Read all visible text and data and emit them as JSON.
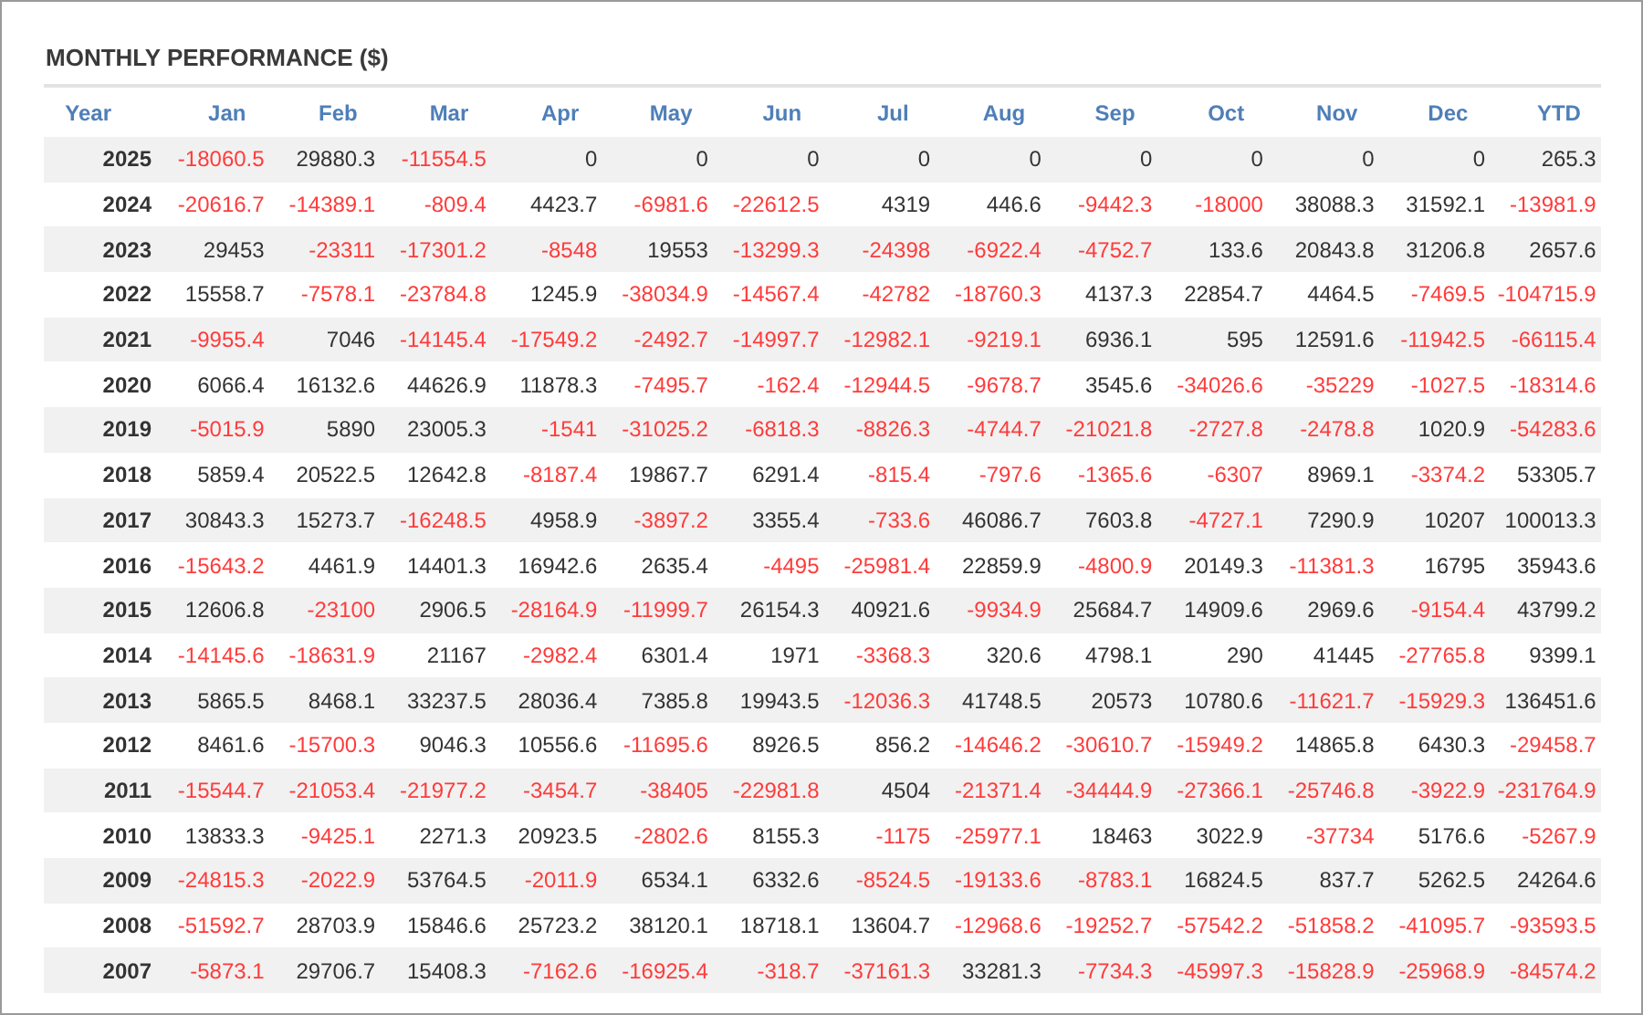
{
  "title": "MONTHLY PERFORMANCE ($)",
  "columns": [
    "Year",
    "Jan",
    "Feb",
    "Mar",
    "Apr",
    "May",
    "Jun",
    "Jul",
    "Aug",
    "Sep",
    "Oct",
    "Nov",
    "Dec",
    "YTD"
  ],
  "rows": [
    [
      "2025",
      "-18060.5",
      "29880.3",
      "-11554.5",
      "0",
      "0",
      "0",
      "0",
      "0",
      "0",
      "0",
      "0",
      "0",
      "265.3"
    ],
    [
      "2024",
      "-20616.7",
      "-14389.1",
      "-809.4",
      "4423.7",
      "-6981.6",
      "-22612.5",
      "4319",
      "446.6",
      "-9442.3",
      "-18000",
      "38088.3",
      "31592.1",
      "-13981.9"
    ],
    [
      "2023",
      "29453",
      "-23311",
      "-17301.2",
      "-8548",
      "19553",
      "-13299.3",
      "-24398",
      "-6922.4",
      "-4752.7",
      "133.6",
      "20843.8",
      "31206.8",
      "2657.6"
    ],
    [
      "2022",
      "15558.7",
      "-7578.1",
      "-23784.8",
      "1245.9",
      "-38034.9",
      "-14567.4",
      "-42782",
      "-18760.3",
      "4137.3",
      "22854.7",
      "4464.5",
      "-7469.5",
      "-104715.9"
    ],
    [
      "2021",
      "-9955.4",
      "7046",
      "-14145.4",
      "-17549.2",
      "-2492.7",
      "-14997.7",
      "-12982.1",
      "-9219.1",
      "6936.1",
      "595",
      "12591.6",
      "-11942.5",
      "-66115.4"
    ],
    [
      "2020",
      "6066.4",
      "16132.6",
      "44626.9",
      "11878.3",
      "-7495.7",
      "-162.4",
      "-12944.5",
      "-9678.7",
      "3545.6",
      "-34026.6",
      "-35229",
      "-1027.5",
      "-18314.6"
    ],
    [
      "2019",
      "-5015.9",
      "5890",
      "23005.3",
      "-1541",
      "-31025.2",
      "-6818.3",
      "-8826.3",
      "-4744.7",
      "-21021.8",
      "-2727.8",
      "-2478.8",
      "1020.9",
      "-54283.6"
    ],
    [
      "2018",
      "5859.4",
      "20522.5",
      "12642.8",
      "-8187.4",
      "19867.7",
      "6291.4",
      "-815.4",
      "-797.6",
      "-1365.6",
      "-6307",
      "8969.1",
      "-3374.2",
      "53305.7"
    ],
    [
      "2017",
      "30843.3",
      "15273.7",
      "-16248.5",
      "4958.9",
      "-3897.2",
      "3355.4",
      "-733.6",
      "46086.7",
      "7603.8",
      "-4727.1",
      "7290.9",
      "10207",
      "100013.3"
    ],
    [
      "2016",
      "-15643.2",
      "4461.9",
      "14401.3",
      "16942.6",
      "2635.4",
      "-4495",
      "-25981.4",
      "22859.9",
      "-4800.9",
      "20149.3",
      "-11381.3",
      "16795",
      "35943.6"
    ],
    [
      "2015",
      "12606.8",
      "-23100",
      "2906.5",
      "-28164.9",
      "-11999.7",
      "26154.3",
      "40921.6",
      "-9934.9",
      "25684.7",
      "14909.6",
      "2969.6",
      "-9154.4",
      "43799.2"
    ],
    [
      "2014",
      "-14145.6",
      "-18631.9",
      "21167",
      "-2982.4",
      "6301.4",
      "1971",
      "-3368.3",
      "320.6",
      "4798.1",
      "290",
      "41445",
      "-27765.8",
      "9399.1"
    ],
    [
      "2013",
      "5865.5",
      "8468.1",
      "33237.5",
      "28036.4",
      "7385.8",
      "19943.5",
      "-12036.3",
      "41748.5",
      "20573",
      "10780.6",
      "-11621.7",
      "-15929.3",
      "136451.6"
    ],
    [
      "2012",
      "8461.6",
      "-15700.3",
      "9046.3",
      "10556.6",
      "-11695.6",
      "8926.5",
      "856.2",
      "-14646.2",
      "-30610.7",
      "-15949.2",
      "14865.8",
      "6430.3",
      "-29458.7"
    ],
    [
      "2011",
      "-15544.7",
      "-21053.4",
      "-21977.2",
      "-3454.7",
      "-38405",
      "-22981.8",
      "4504",
      "-21371.4",
      "-34444.9",
      "-27366.1",
      "-25746.8",
      "-3922.9",
      "-231764.9"
    ],
    [
      "2010",
      "13833.3",
      "-9425.1",
      "2271.3",
      "20923.5",
      "-2802.6",
      "8155.3",
      "-1175",
      "-25977.1",
      "18463",
      "3022.9",
      "-37734",
      "5176.6",
      "-5267.9"
    ],
    [
      "2009",
      "-24815.3",
      "-2022.9",
      "53764.5",
      "-2011.9",
      "6534.1",
      "6332.6",
      "-8524.5",
      "-19133.6",
      "-8783.1",
      "16824.5",
      "837.7",
      "5262.5",
      "24264.6"
    ],
    [
      "2008",
      "-51592.7",
      "28703.9",
      "15846.6",
      "25723.2",
      "38120.1",
      "18718.1",
      "13604.7",
      "-12968.6",
      "-19252.7",
      "-57542.2",
      "-51858.2",
      "-41095.7",
      "-93593.5"
    ],
    [
      "2007",
      "-5873.1",
      "29706.7",
      "15408.3",
      "-7162.6",
      "-16925.4",
      "-318.7",
      "-37161.3",
      "33281.3",
      "-7734.3",
      "-45997.3",
      "-15828.9",
      "-25968.9",
      "-84574.2"
    ]
  ]
}
